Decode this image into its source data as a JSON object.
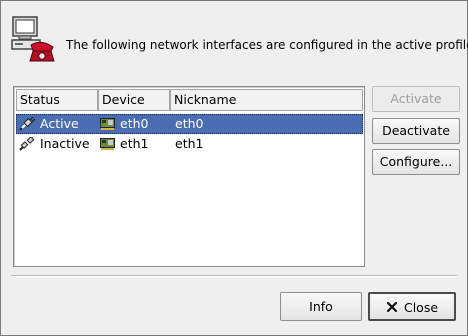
{
  "header": {
    "icon": "network-computer-icon",
    "message": "The following network interfaces are configured in the active profile."
  },
  "table": {
    "columns": [
      "Status",
      "Device",
      "Nickname"
    ],
    "rows": [
      {
        "status": "Active",
        "device": "eth0",
        "nickname": "eth0",
        "selected": true
      },
      {
        "status": "Inactive",
        "device": "eth1",
        "nickname": "eth1",
        "selected": false
      }
    ]
  },
  "side_buttons": {
    "activate": "Activate",
    "deactivate": "Deactivate",
    "configure": "Configure..."
  },
  "footer": {
    "info": "Info",
    "close": "Close"
  },
  "colors": {
    "selection": "#4a6cb0",
    "dialog_bg": "#efefef"
  }
}
